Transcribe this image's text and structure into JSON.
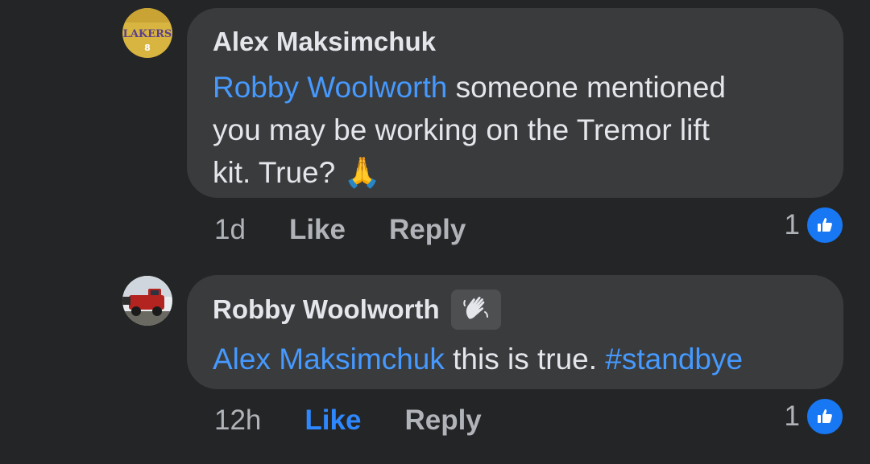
{
  "comments": [
    {
      "author": "Alex Maksimchuk",
      "mention": "Robby Woolworth",
      "text_line1": " someone mentioned",
      "text_line2": "you may be working on the Tremor lift",
      "text_line3": "kit. True? ",
      "emoji": "🙏",
      "time": "1d",
      "like_label": "Like",
      "reply_label": "Reply",
      "reaction_count": "1",
      "liked_by_viewer": false
    },
    {
      "author": "Robby Woolworth",
      "author_badge": "wave-icon",
      "mention": "Alex Maksimchuk",
      "text": " this is true. ",
      "hashtag": "#standbye",
      "time": "12h",
      "like_label": "Like",
      "reply_label": "Reply",
      "reaction_count": "1",
      "liked_by_viewer": true
    }
  ],
  "colors": {
    "background": "#242526",
    "bubble": "#3a3b3c",
    "link": "#4599ff",
    "liked": "#2d88ff",
    "muted": "#b0b3b8",
    "like_badge": "#1877f2"
  }
}
